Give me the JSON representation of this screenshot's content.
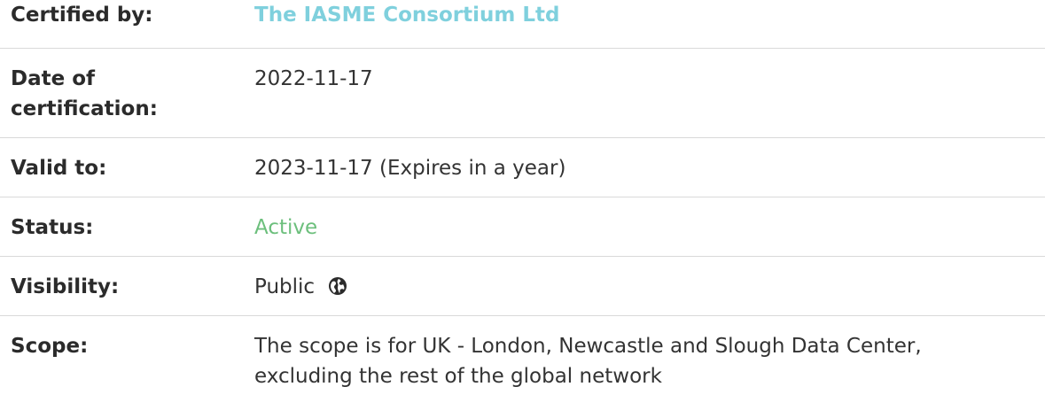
{
  "certificate": {
    "certified_by": {
      "label": "Certified by:",
      "value": "The IASME Consortium Ltd"
    },
    "date_of_certification": {
      "label_line1": "Date of",
      "label_line2": "certification:",
      "value": "2022-11-17"
    },
    "valid_to": {
      "label": "Valid to:",
      "value": "2023-11-17 (Expires in a year)"
    },
    "status": {
      "label": "Status:",
      "value": "Active"
    },
    "visibility": {
      "label": "Visibility:",
      "value": "Public",
      "icon": "globe-icon"
    },
    "scope": {
      "label": "Scope:",
      "value_line1": "The scope is for UK - London, Newcastle and Slough Data Center,",
      "value_line2": "excluding the rest of the global network"
    }
  },
  "colors": {
    "link": "#7fd0dd",
    "active": "#6cbf7c",
    "divider": "#d9d9d9",
    "text": "#333333"
  }
}
